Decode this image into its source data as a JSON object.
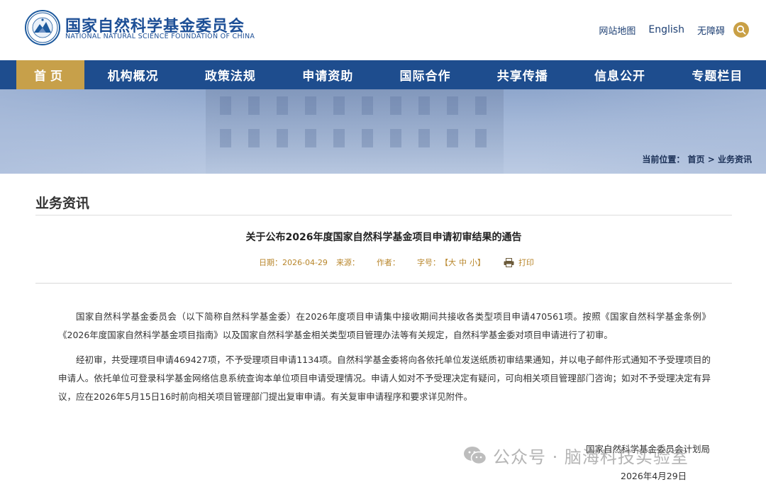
{
  "header": {
    "org_name_cn": "国家自然科学基金委员会",
    "org_name_en": "NATIONAL NATURAL SCIENCE FOUNDATION OF CHINA",
    "logo_emblem_text": "国家自然科学基金委员会",
    "links": {
      "sitemap": "网站地图",
      "english": "English",
      "accessibility": "无障碍"
    },
    "search_icon": "search-icon"
  },
  "nav": {
    "items": [
      {
        "label": "首页"
      },
      {
        "label": "机构概况"
      },
      {
        "label": "政策法规"
      },
      {
        "label": "申请资助"
      },
      {
        "label": "国际合作"
      },
      {
        "label": "共享传播"
      },
      {
        "label": "信息公开"
      },
      {
        "label": "专题栏目"
      }
    ]
  },
  "breadcrumb": {
    "prefix": "当前位置：",
    "home": "首页",
    "sep": ">",
    "current": "业务资讯"
  },
  "section": {
    "title": "业务资讯"
  },
  "article": {
    "title": "关于公布2026年度国家自然科学基金项目申请初审结果的通告",
    "meta": {
      "date_label": "日期：",
      "date": "2026-04-29",
      "source_label": "来源：",
      "author_label": "作者：",
      "font_size_label": "字号：",
      "bracket_open": "【",
      "size_large": "大",
      "size_medium": "中",
      "size_small": "小",
      "bracket_close": "】",
      "print_label": "打印"
    },
    "paragraphs": [
      "国家自然科学基金委员会（以下简称自然科学基金委）在2026年度项目申请集中接收期间共接收各类型项目申请470561项。按照《国家自然科学基金条例》《2026年度国家自然科学基金项目指南》以及国家自然科学基金相关类型项目管理办法等有关规定，自然科学基金委对项目申请进行了初审。",
      "经初审，共受理项目申请469427项，不予受理项目申请1134项。自然科学基金委将向各依托单位发送纸质初审结果通知，并以电子邮件形式通知不予受理项目的申请人。依托单位可登录科学基金网络信息系统查询本单位项目申请受理情况。申请人如对不予受理决定有疑问，可向相关项目管理部门咨询；如对不予受理决定有异议，应在2026年5月15日16时前向相关项目管理部门提出复审申请。有关复审申请程序和要求详见附件。"
    ],
    "signature": {
      "org": "国家自然科学基金委员会计划局",
      "date": "2026年4月29日"
    }
  },
  "watermark": {
    "text": "公众号 · 脑海科技实验室",
    "icon": "wechat-icon"
  },
  "colors": {
    "nav_bg": "#1e4d8e",
    "accent_gold": "#c7a04a",
    "meta_gold": "#b8862b",
    "brand_blue": "#1d4f96"
  }
}
